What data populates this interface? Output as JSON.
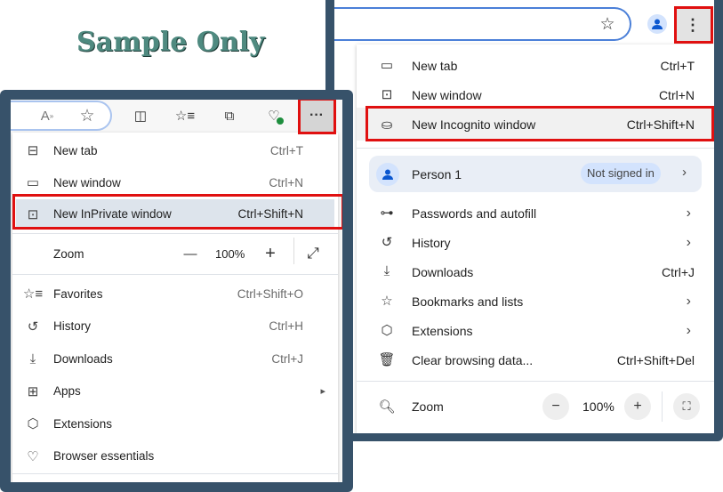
{
  "watermark": "Sample Only",
  "chrome": {
    "menu": [
      {
        "label": "New tab",
        "shortcut": "Ctrl+T",
        "icon": "new-tab-icon"
      },
      {
        "label": "New window",
        "shortcut": "Ctrl+N",
        "icon": "new-window-icon"
      },
      {
        "label": "New Incognito window",
        "shortcut": "Ctrl+Shift+N",
        "icon": "incognito-icon"
      }
    ],
    "profile": {
      "name": "Person 1",
      "status": "Not signed in"
    },
    "menu2": [
      {
        "label": "Passwords and autofill",
        "shortcut": "",
        "arrow": "›",
        "icon": "key-icon"
      },
      {
        "label": "History",
        "shortcut": "",
        "arrow": "›",
        "icon": "history-icon"
      },
      {
        "label": "Downloads",
        "shortcut": "Ctrl+J",
        "arrow": "",
        "icon": "download-icon"
      },
      {
        "label": "Bookmarks and lists",
        "shortcut": "",
        "arrow": "›",
        "icon": "star-icon"
      },
      {
        "label": "Extensions",
        "shortcut": "",
        "arrow": "›",
        "icon": "extensions-icon"
      },
      {
        "label": "Clear browsing data...",
        "shortcut": "Ctrl+Shift+Del",
        "arrow": "",
        "icon": "trash-icon"
      }
    ],
    "zoom": {
      "label": "Zoom",
      "value": "100%",
      "minus": "−",
      "plus": "+"
    }
  },
  "edge": {
    "menu": [
      {
        "label": "New tab",
        "shortcut": "Ctrl+T"
      },
      {
        "label": "New window",
        "shortcut": "Ctrl+N"
      },
      {
        "label": "New InPrivate window",
        "shortcut": "Ctrl+Shift+N"
      }
    ],
    "zoom": {
      "label": "Zoom",
      "value": "100%",
      "minus": "—",
      "plus": "+"
    },
    "menu2": [
      {
        "label": "Favorites",
        "shortcut": "Ctrl+Shift+O"
      },
      {
        "label": "History",
        "shortcut": "Ctrl+H"
      },
      {
        "label": "Downloads",
        "shortcut": "Ctrl+J"
      },
      {
        "label": "Apps",
        "shortcut": "▸"
      },
      {
        "label": "Extensions",
        "shortcut": ""
      },
      {
        "label": "Browser essentials",
        "shortcut": ""
      }
    ]
  }
}
